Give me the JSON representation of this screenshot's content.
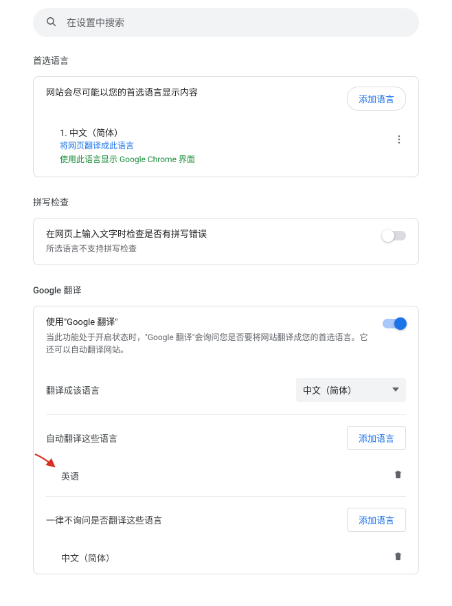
{
  "search": {
    "placeholder": "在设置中搜索"
  },
  "preferred": {
    "section_title": "首选语言",
    "desc": "网站会尽可能以您的首选语言显示内容",
    "add_button": "添加语言",
    "item": {
      "order": "1. 中文（简体）",
      "translate_line": "将网页翻译成此语言",
      "chrome_line": "使用此语言显示 Google Chrome 界面"
    }
  },
  "spellcheck": {
    "section_title": "拼写检查",
    "title": "在网页上输入文字时检查是否有拼写错误",
    "desc": "所选语言不支持拼写检查"
  },
  "translate": {
    "section_title": "Google 翻译",
    "enable_title": "使用\"Google 翻译\"",
    "enable_desc": "当此功能处于开启状态时，\"Google 翻译\"会询问您是否要将网站翻译成您的首选语言。它还可以自动翻译网站。",
    "target_label": "翻译成该语言",
    "target_value": "中文（简体）",
    "auto": {
      "label": "自动翻译这些语言",
      "add_button": "添加语言",
      "items": [
        "英语"
      ]
    },
    "never": {
      "label": "一律不询问是否翻译这些语言",
      "add_button": "添加语言",
      "items": [
        "中文（简体）"
      ]
    }
  }
}
